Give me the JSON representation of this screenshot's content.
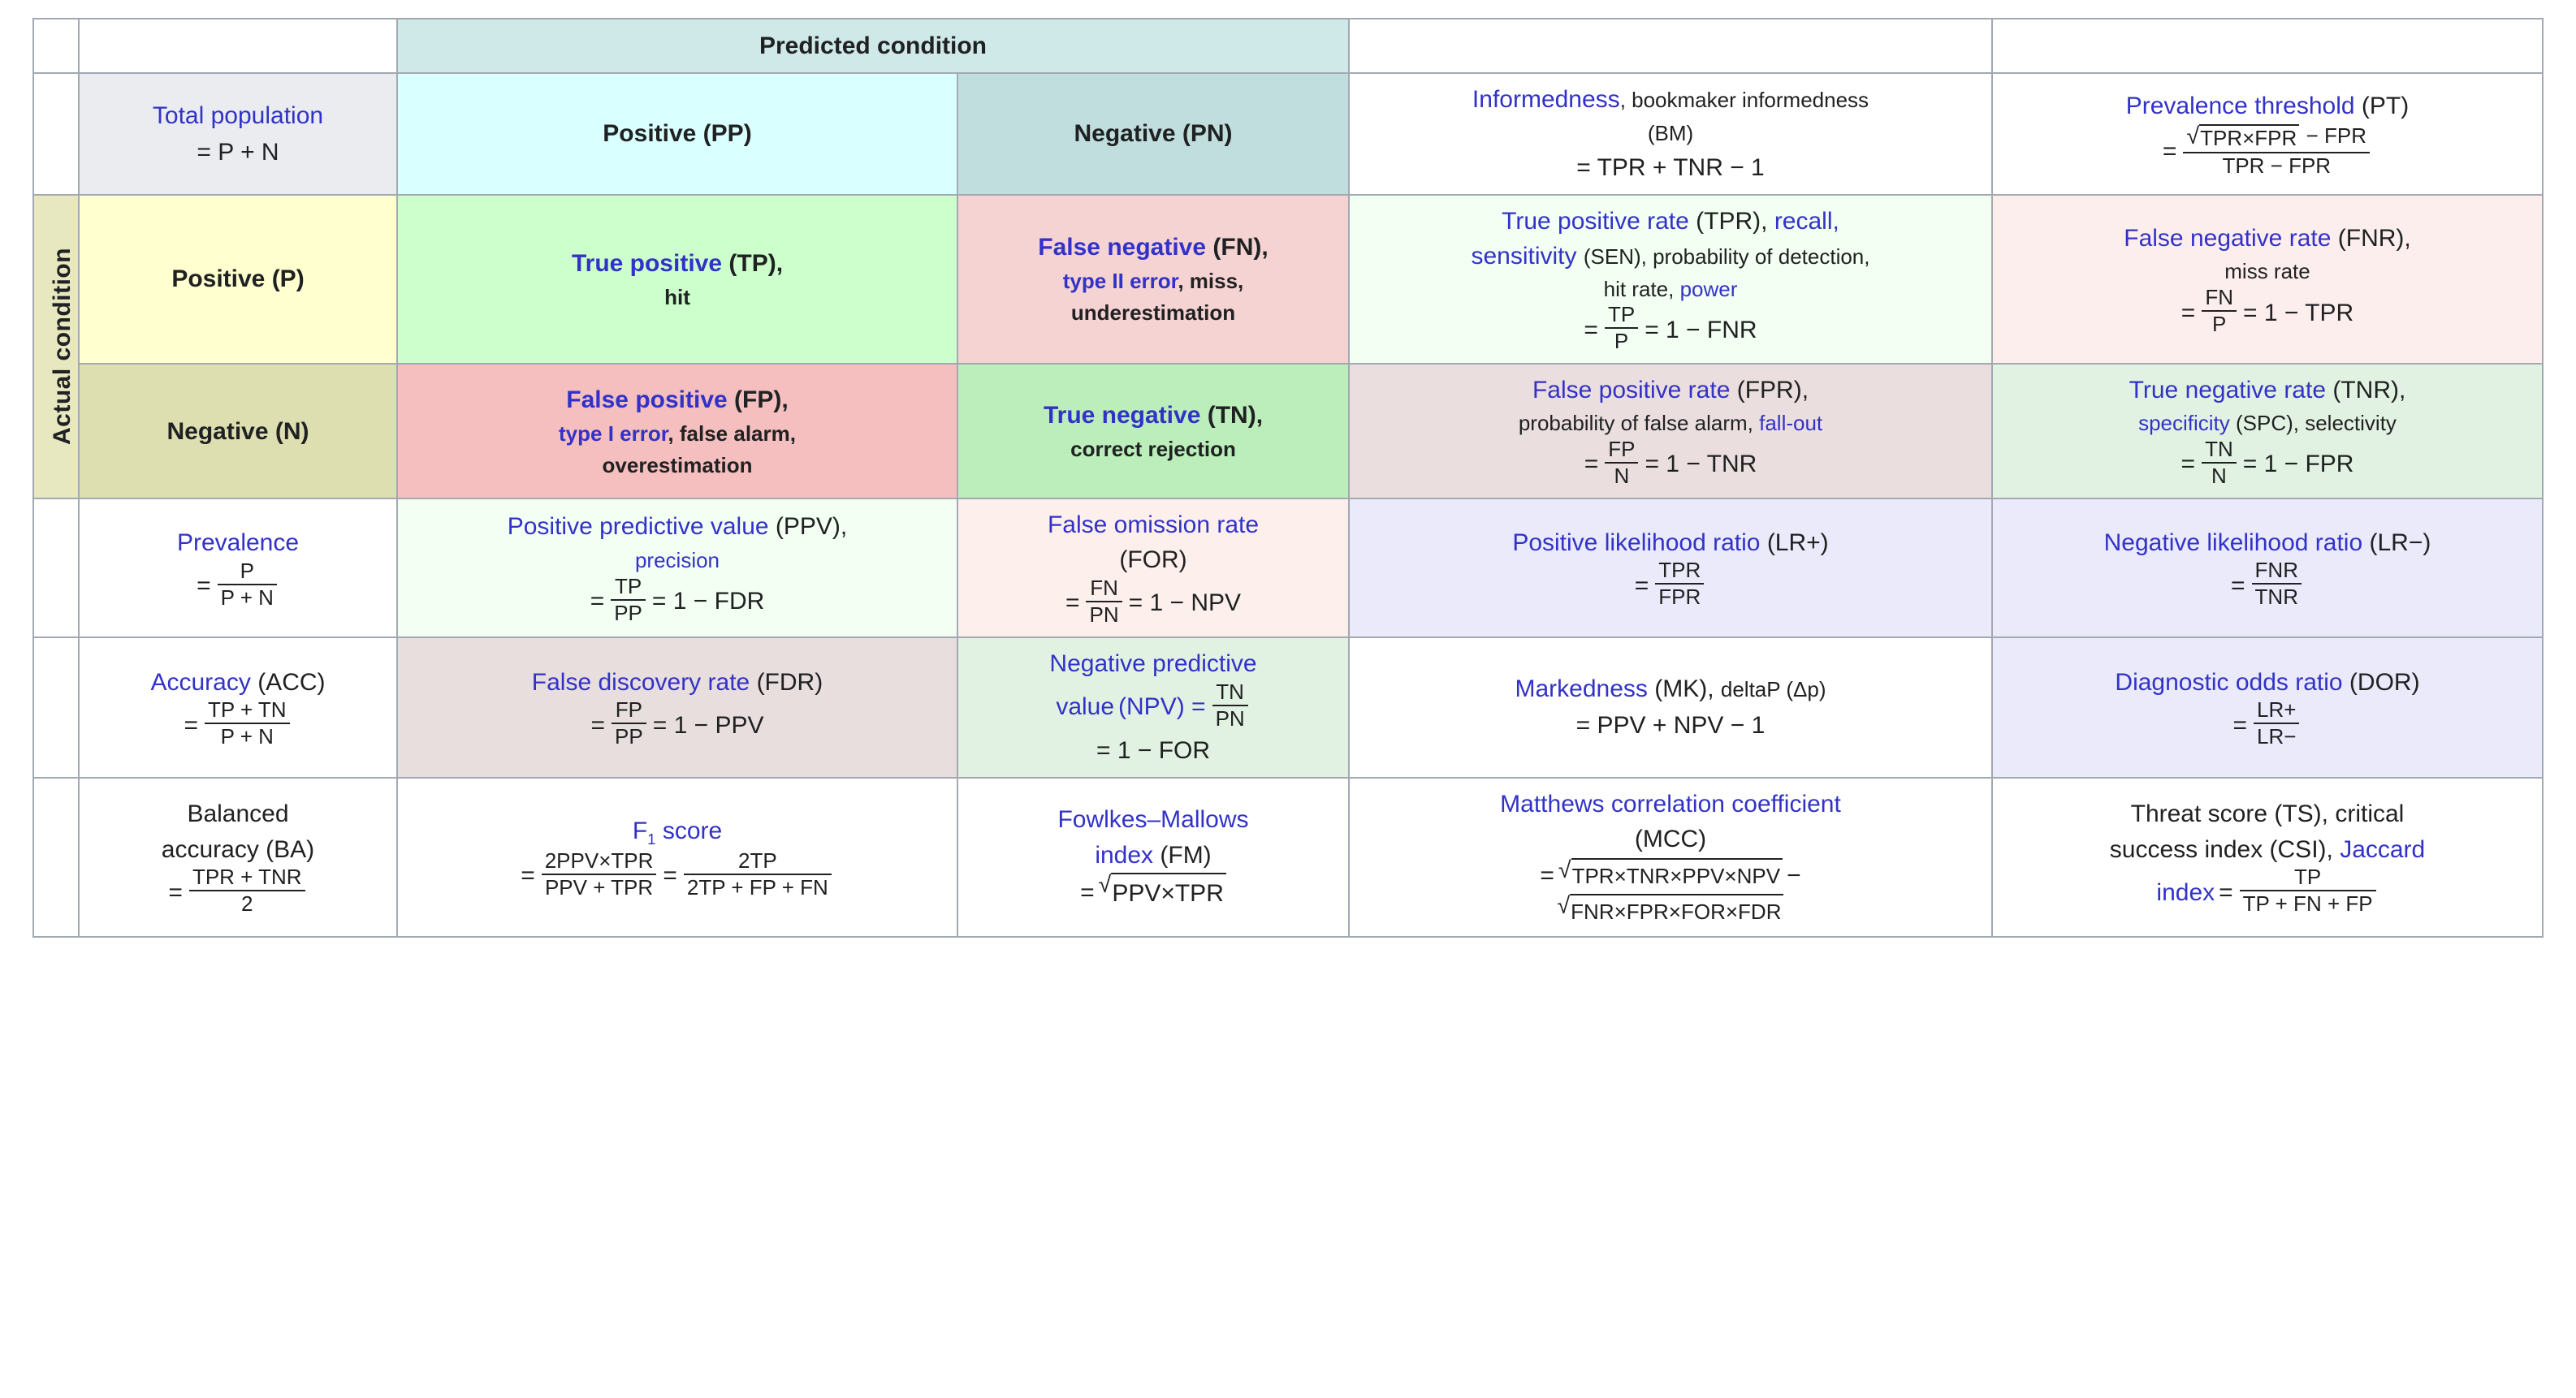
{
  "title": "Confusion matrix / diagnostic testing metrics table",
  "colors": {
    "link_blue": "#3232c8",
    "text": "#202122",
    "border": "#a2a9b1",
    "predicted_header_bg": "#cfe8e8",
    "total_population_bg": "#eaecf0",
    "pp_bg": "#d9ffff",
    "pn_bg": "#c0dede",
    "actual_condition_bg": "#e8e8c0",
    "positive_p_bg": "#ffffd0",
    "negative_n_bg": "#dddfb0",
    "tp_bg": "#ccffcc",
    "fn_bg": "#f5d3d3",
    "fp_bg": "#f5bfbf",
    "tn_bg": "#bbeebb"
  },
  "headers": {
    "predicted_condition": "Predicted condition",
    "actual_condition": "Actual condition",
    "total_population_label": "Total population",
    "total_population_formula": "= P + N",
    "pp": "Positive (PP)",
    "pn": "Negative (PN)",
    "actual_positive": "Positive (P)",
    "actual_negative": "Negative (N)"
  },
  "cells": {
    "informedness": {
      "name": "Informedness",
      "alt1": ", bookmaker informedness",
      "alt2": "(BM)",
      "formula": "= TPR + TNR − 1"
    },
    "prevalence_threshold": {
      "name": "Prevalence threshold",
      "abbr": "(PT)",
      "eq": "=",
      "num_radicand": "TPR×FPR",
      "num_tail": "− FPR",
      "den": "TPR − FPR"
    },
    "true_positive": {
      "name": "True positive",
      "abbr": "(TP),",
      "alt": "hit"
    },
    "false_negative": {
      "name": "False negative",
      "abbr": "(FN),",
      "alt1": "type II error",
      "alt1_tail": ", miss,",
      "alt2": "underestimation"
    },
    "false_positive": {
      "name": "False positive",
      "abbr": "(FP),",
      "alt1": "type I error",
      "alt1_tail": ", false alarm,",
      "alt2": "overestimation"
    },
    "true_negative": {
      "name": "True negative",
      "abbr": "(TN),",
      "alt": "correct rejection"
    },
    "tpr": {
      "name": "True positive rate",
      "abbr": "(TPR),",
      "alt1": "recall,",
      "alt2": "sensitivity",
      "alt2_abbr": "(SEN), probability of detection,",
      "alt3": "hit rate,",
      "alt4": "power",
      "eq": "=",
      "num": "TP",
      "den": "P",
      "tail": "= 1 − FNR"
    },
    "fnr": {
      "name": "False negative rate",
      "abbr": "(FNR),",
      "alt": "miss rate",
      "eq": "=",
      "num": "FN",
      "den": "P",
      "tail": "= 1 − TPR"
    },
    "fpr": {
      "name": "False positive rate",
      "abbr": "(FPR),",
      "alt1": "probability of false alarm,",
      "alt2": "fall-out",
      "eq": "=",
      "num": "FP",
      "den": "N",
      "tail": "= 1 − TNR"
    },
    "tnr": {
      "name": "True negative rate",
      "abbr": "(TNR),",
      "alt1": "specificity",
      "alt1_tail": "(SPC), selectivity",
      "eq": "=",
      "num": "TN",
      "den": "N",
      "tail": "= 1 − FPR"
    },
    "prevalence": {
      "name": "Prevalence",
      "eq": "=",
      "num": "P",
      "den": "P + N"
    },
    "ppv": {
      "name": "Positive predictive value",
      "abbr": "(PPV),",
      "alt": "precision",
      "eq": "=",
      "num": "TP",
      "den": "PP",
      "tail": "= 1 − FDR"
    },
    "for": {
      "name": "False omission rate",
      "abbr": "(FOR)",
      "eq": "=",
      "num": "FN",
      "den": "PN",
      "tail": "= 1 − NPV"
    },
    "lr_plus": {
      "name": "Positive likelihood ratio",
      "abbr": "(LR+)",
      "eq": "=",
      "num": "TPR",
      "den": "FPR"
    },
    "lr_minus": {
      "name": "Negative likelihood ratio",
      "abbr": "(LR−)",
      "eq": "=",
      "num": "FNR",
      "den": "TNR"
    },
    "accuracy": {
      "name": "Accuracy",
      "abbr": "(ACC)",
      "eq": "=",
      "num": "TP + TN",
      "den": "P + N"
    },
    "fdr": {
      "name": "False discovery rate",
      "abbr": "(FDR)",
      "eq": "=",
      "num": "FP",
      "den": "PP",
      "tail": "= 1 − PPV"
    },
    "npv": {
      "name_line1": "Negative predictive",
      "name_line2": "value",
      "abbr": "(NPV) =",
      "num": "TN",
      "den": "PN",
      "tail": "= 1 − FOR"
    },
    "markedness": {
      "name": "Markedness",
      "abbr": "(MK),",
      "alt": "deltaP (Δp)",
      "formula": "= PPV + NPV − 1"
    },
    "dor": {
      "name": "Diagnostic odds ratio",
      "abbr": "(DOR)",
      "eq": "=",
      "num": "LR+",
      "den": "LR−"
    },
    "balanced_accuracy": {
      "name_line1": "Balanced",
      "name_line2": "accuracy (BA)",
      "eq": "=",
      "num": "TPR + TNR",
      "den": "2"
    },
    "f1": {
      "name": "F",
      "sub": "1",
      "name_tail": " score",
      "eq": "=",
      "num1": "2PPV×TPR",
      "den1": "PPV + TPR",
      "eq2": "=",
      "num2": "2TP",
      "den2": "2TP + FP + FN"
    },
    "fm": {
      "name_line1": "Fowlkes–Mallows",
      "name_line2": "index",
      "abbr": "(FM)",
      "eq": "=",
      "radicand": "PPV×TPR"
    },
    "mcc": {
      "name": "Matthews correlation coefficient",
      "abbr": "(MCC)",
      "eq": "=",
      "radicand1": "TPR×TNR×PPV×NPV",
      "minus": "−",
      "radicand2": "FNR×FPR×FOR×FDR"
    },
    "threat_score": {
      "line1": "Threat score (TS), critical",
      "line2a": "success index (CSI), ",
      "line2b": "Jaccard",
      "line3a": "index",
      "eq": "=",
      "num": "TP",
      "den": "TP + FN + FP"
    }
  }
}
